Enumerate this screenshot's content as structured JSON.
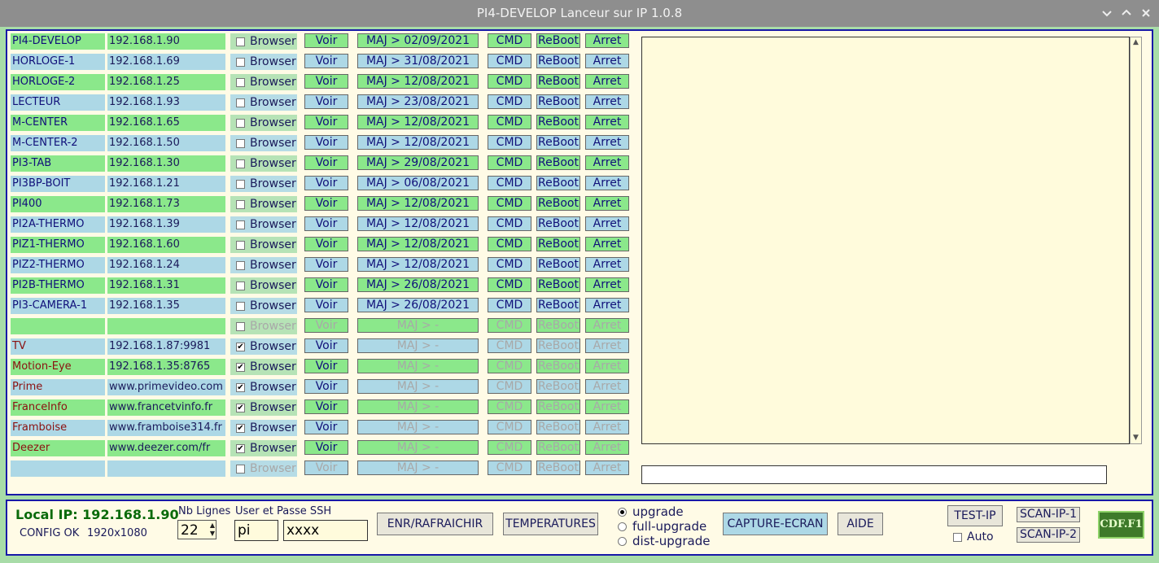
{
  "window": {
    "title": "PI4-DEVELOP  Lanceur sur IP  1.0.8",
    "controls": [
      "minimize-icon",
      "maximize-icon",
      "close-icon"
    ]
  },
  "colors": {
    "row_green": "#8be88b",
    "row_blue": "#add8e6",
    "frame_border": "#1818a8",
    "panel_bg": "#fffbe6",
    "window_bg": "#a8dca8"
  },
  "labels": {
    "browser": "Browser",
    "voir": "Voir",
    "cmd": "CMD",
    "reboot": "ReBoot",
    "arret": "Arret"
  },
  "rows": [
    {
      "name": "PI4-DEVELOP",
      "ip": "192.168.1.90",
      "browser": false,
      "maj": "MAJ > 02/09/2021",
      "enabled": true,
      "name_color": "blue"
    },
    {
      "name": "HORLOGE-1",
      "ip": "192.168.1.69",
      "browser": false,
      "maj": "MAJ > 31/08/2021",
      "enabled": true,
      "name_color": "blue"
    },
    {
      "name": "HORLOGE-2",
      "ip": "192.168.1.25",
      "browser": false,
      "maj": "MAJ > 12/08/2021",
      "enabled": true,
      "name_color": "blue"
    },
    {
      "name": "LECTEUR",
      "ip": "192.168.1.93",
      "browser": false,
      "maj": "MAJ > 23/08/2021",
      "enabled": true,
      "name_color": "blue"
    },
    {
      "name": "M-CENTER",
      "ip": "192.168.1.65",
      "browser": false,
      "maj": "MAJ > 12/08/2021",
      "enabled": true,
      "name_color": "blue"
    },
    {
      "name": "M-CENTER-2",
      "ip": "192.168.1.50",
      "browser": false,
      "maj": "MAJ > 12/08/2021",
      "enabled": true,
      "name_color": "blue"
    },
    {
      "name": "PI3-TAB",
      "ip": "192.168.1.30",
      "browser": false,
      "maj": "MAJ > 29/08/2021",
      "enabled": true,
      "name_color": "blue"
    },
    {
      "name": "PI3BP-BOIT",
      "ip": "192.168.1.21",
      "browser": false,
      "maj": "MAJ > 06/08/2021",
      "enabled": true,
      "name_color": "blue"
    },
    {
      "name": "PI400",
      "ip": "192.168.1.73",
      "browser": false,
      "maj": "MAJ > 12/08/2021",
      "enabled": true,
      "name_color": "blue"
    },
    {
      "name": "PI2A-THERMO",
      "ip": "192.168.1.39",
      "browser": false,
      "maj": "MAJ > 12/08/2021",
      "enabled": true,
      "name_color": "blue"
    },
    {
      "name": "PIZ1-THERMO",
      "ip": "192.168.1.60",
      "browser": false,
      "maj": "MAJ > 12/08/2021",
      "enabled": true,
      "name_color": "blue"
    },
    {
      "name": "PIZ2-THERMO",
      "ip": "192.168.1.24",
      "browser": false,
      "maj": "MAJ > 12/08/2021",
      "enabled": true,
      "name_color": "blue"
    },
    {
      "name": "PI2B-THERMO",
      "ip": "192.168.1.31",
      "browser": false,
      "maj": "MAJ > 26/08/2021",
      "enabled": true,
      "name_color": "blue"
    },
    {
      "name": "PI3-CAMERA-1",
      "ip": "192.168.1.35",
      "browser": false,
      "maj": "MAJ > 26/08/2021",
      "enabled": true,
      "name_color": "blue"
    },
    {
      "name": "",
      "ip": "",
      "browser": false,
      "maj": "MAJ > -",
      "enabled": false,
      "browser_enabled": false,
      "voir_enabled": false,
      "name_color": "blue"
    },
    {
      "name": "TV",
      "ip": "192.168.1.87:9981",
      "browser": true,
      "maj": "MAJ > -",
      "enabled": false,
      "browser_enabled": true,
      "voir_enabled": true,
      "name_color": "red"
    },
    {
      "name": "Motion-Eye",
      "ip": "192.168.1.35:8765",
      "browser": true,
      "maj": "MAJ > -",
      "enabled": false,
      "browser_enabled": true,
      "voir_enabled": true,
      "name_color": "red"
    },
    {
      "name": "Prime",
      "ip": "www.primevideo.com",
      "browser": true,
      "maj": "MAJ > -",
      "enabled": false,
      "browser_enabled": true,
      "voir_enabled": true,
      "name_color": "red"
    },
    {
      "name": "FranceInfo",
      "ip": "www.francetvinfo.fr",
      "browser": true,
      "maj": "MAJ > -",
      "enabled": false,
      "browser_enabled": true,
      "voir_enabled": true,
      "name_color": "red"
    },
    {
      "name": "Framboise",
      "ip": "www.framboise314.fr",
      "browser": true,
      "maj": "MAJ > -",
      "enabled": false,
      "browser_enabled": true,
      "voir_enabled": true,
      "name_color": "red"
    },
    {
      "name": "Deezer",
      "ip": "www.deezer.com/fr",
      "browser": true,
      "maj": "MAJ > -",
      "enabled": false,
      "browser_enabled": true,
      "voir_enabled": true,
      "name_color": "red"
    },
    {
      "name": "",
      "ip": "",
      "browser": false,
      "maj": "MAJ > -",
      "enabled": false,
      "browser_enabled": false,
      "voir_enabled": false,
      "name_color": "blue"
    }
  ],
  "log": {
    "text": ""
  },
  "command": {
    "value": ""
  },
  "bottom": {
    "local_ip": "Local IP: 192.168.1.90",
    "config_status": "CONFIG OK",
    "resolution": "1920x1080",
    "nb_lignes_label": "Nb Lignes",
    "nb_lignes_value": "22",
    "ssh_label": "User et Passe SSH",
    "ssh_user": "pi",
    "ssh_pass": "xxxx",
    "enr_button": "ENR/RAFRAICHIR",
    "temp_button": "TEMPERATURES",
    "upgrade_options": [
      "upgrade",
      "full-upgrade",
      "dist-upgrade"
    ],
    "upgrade_selected": "upgrade",
    "capture_button": "CAPTURE-ECRAN",
    "aide_button": "AIDE",
    "test_ip_button": "TEST-IP",
    "auto_label": "Auto",
    "auto_checked": false,
    "scan1_button": "SCAN-IP-1",
    "scan2_button": "SCAN-IP-2",
    "logo_text": "CDF.F1"
  }
}
